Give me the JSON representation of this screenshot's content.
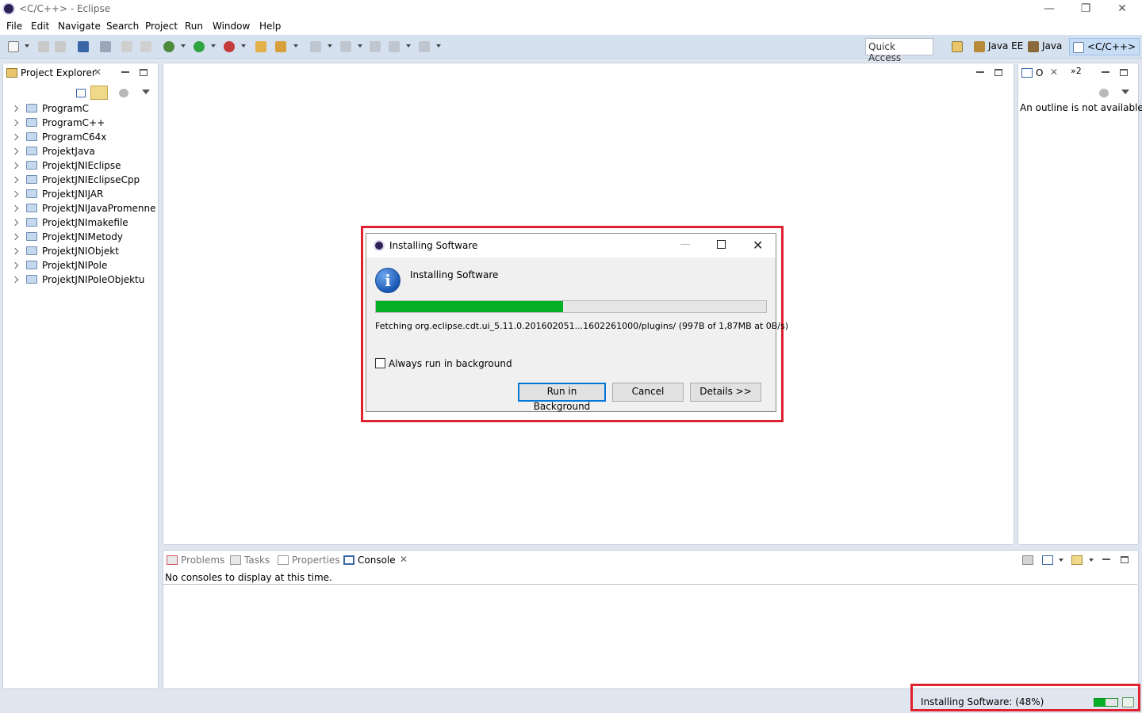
{
  "window": {
    "title": "<C/C++> - Eclipse",
    "minimize_glyph": "—",
    "restore_glyph": "❐",
    "close_glyph": "✕"
  },
  "menu": {
    "items": [
      "File",
      "Edit",
      "Navigate",
      "Search",
      "Project",
      "Run",
      "Window",
      "Help"
    ]
  },
  "toolbar": {
    "quick_access": "Quick Access",
    "perspectives": [
      "Java EE",
      "Java",
      "<C/C++>"
    ],
    "active_perspective": "<C/C++>"
  },
  "project_explorer": {
    "tab_label": "Project Explorer",
    "projects": [
      "ProgramC",
      "ProgramC++",
      "ProgramC64x",
      "ProjektJava",
      "ProjektJNIEclipse",
      "ProjektJNIEclipseCpp",
      "ProjektJNIJAR",
      "ProjektJNIJavaPromenne",
      "ProjektJNImakefile",
      "ProjektJNIMetody",
      "ProjektJNIObjekt",
      "ProjektJNIPole",
      "ProjektJNIPoleObjektu"
    ]
  },
  "outline": {
    "tab_label": "O",
    "overflow_label": "»2",
    "message": "An outline is not available."
  },
  "bottom_panel": {
    "tabs": [
      "Problems",
      "Tasks",
      "Properties",
      "Console"
    ],
    "active_tab": "Console",
    "console_message": "No consoles to display at this time."
  },
  "dialog": {
    "title": "Installing Software",
    "heading": "Installing Software",
    "progress_percent": 48,
    "detail": "Fetching org.eclipse.cdt.ui_5.11.0.201602051...1602261000/plugins/ (997B of 1,87MB at 0B/s)",
    "checkbox_label": "Always run in background",
    "checkbox_checked": false,
    "buttons": {
      "run_in_background": "Run in Background",
      "cancel": "Cancel",
      "details": "Details >>"
    }
  },
  "status_bar": {
    "text": "Installing Software: (48%)",
    "progress_percent": 48
  },
  "colors": {
    "highlight": "#e0212f",
    "progress": "#06b025",
    "toolbar": "#d6e1ef"
  }
}
